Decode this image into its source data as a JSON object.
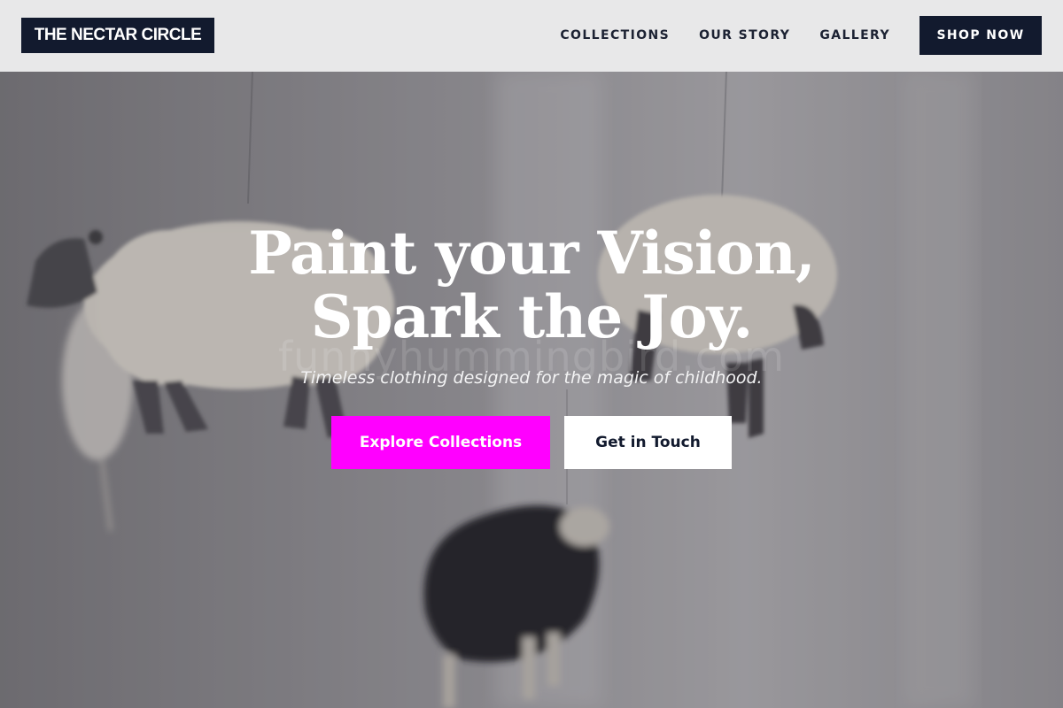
{
  "header": {
    "logo_text": "THE NECTAR CIRCLE",
    "nav": [
      {
        "label": "COLLECTIONS"
      },
      {
        "label": "OUR STORY"
      },
      {
        "label": "GALLERY"
      }
    ],
    "shop_button_label": "SHOP NOW"
  },
  "hero": {
    "headline": "Paint your Vision, Spark the Joy.",
    "subtitle": "Timeless clothing designed for the magic of childhood.",
    "primary_cta_label": "Explore Collections",
    "secondary_cta_label": "Get in Touch",
    "watermark": "funnyhummingbird.com",
    "background_image": "felt-sheep-mobile"
  },
  "colors": {
    "brand_dark": "#121a2e",
    "accent_magenta": "#ff00ff",
    "header_bg": "#e8e8e9"
  }
}
